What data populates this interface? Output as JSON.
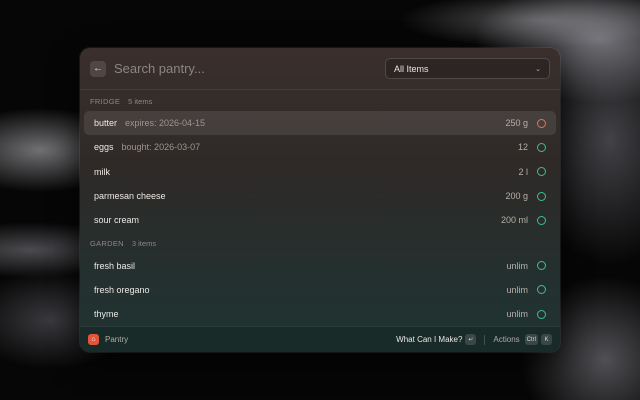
{
  "search": {
    "placeholder": "Search pantry..."
  },
  "filter": {
    "selected": "All Items"
  },
  "sections": [
    {
      "title": "FRIDGE",
      "count": "5 items",
      "items": [
        {
          "name": "butter",
          "sub": "expires: 2026-04-15",
          "qty": "250 g",
          "status": "warning"
        },
        {
          "name": "eggs",
          "sub": "bought: 2026-03-07",
          "qty": "12",
          "status": "ok"
        },
        {
          "name": "milk",
          "sub": "",
          "qty": "2 l",
          "status": "ok"
        },
        {
          "name": "parmesan cheese",
          "sub": "",
          "qty": "200 g",
          "status": "ok"
        },
        {
          "name": "sour cream",
          "sub": "",
          "qty": "200 ml",
          "status": "ok"
        }
      ]
    },
    {
      "title": "GARDEN",
      "count": "3 items",
      "items": [
        {
          "name": "fresh basil",
          "sub": "",
          "qty": "unlim",
          "status": "ok"
        },
        {
          "name": "fresh oregano",
          "sub": "",
          "qty": "unlim",
          "status": "ok"
        },
        {
          "name": "thyme",
          "sub": "",
          "qty": "unlim",
          "status": "ok"
        }
      ]
    }
  ],
  "footer": {
    "app_name": "Pantry",
    "primary_action": "What Can I Make?",
    "enter_key": "↵",
    "actions_label": "Actions",
    "ctrl_key": "Ctrl",
    "k_key": "K"
  },
  "colors": {
    "ok": "#3fbf8c",
    "warning": "#e0735a",
    "app_icon": "#e2553a"
  },
  "icons": {
    "back": "arrow-left-icon",
    "chevron": "chevron-down-icon",
    "app": "pantry-icon"
  }
}
